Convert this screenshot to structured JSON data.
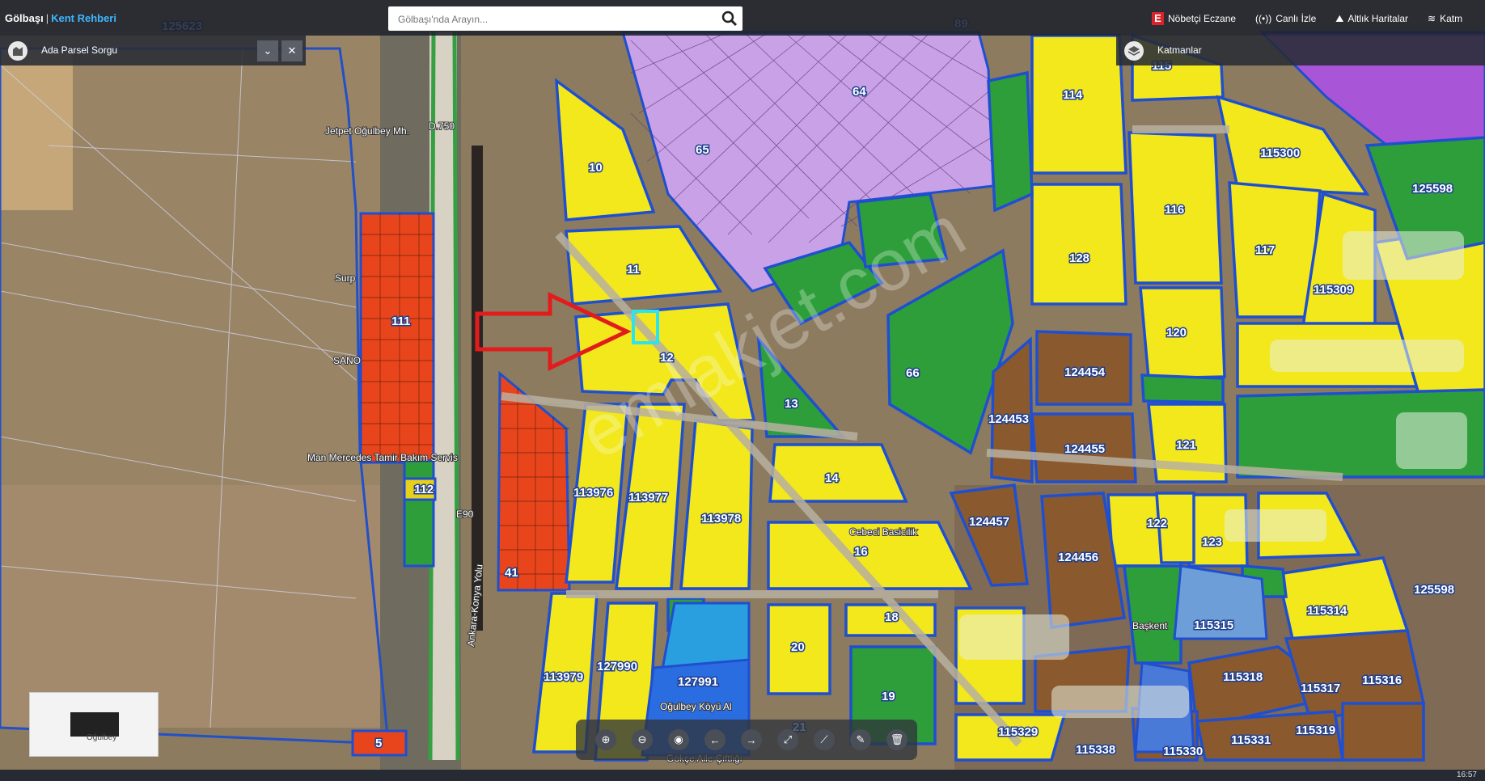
{
  "app": {
    "brand": "Gölbaşı",
    "brand_sub": "Kent Rehberi"
  },
  "search": {
    "placeholder": "Gölbaşı'nda Arayın..."
  },
  "top_links": [
    {
      "label": "Nöbetçi Eczane",
      "icon": "pharmacy-icon"
    },
    {
      "label": "Canlı İzle",
      "icon": "live-icon"
    },
    {
      "label": "Altlık Haritalar",
      "icon": "basemap-icon"
    },
    {
      "label": "Katm",
      "icon": "layers-icon"
    }
  ],
  "left_panel": {
    "title": "Ada Parsel Sorgu"
  },
  "right_panel": {
    "title": "Katmanlar"
  },
  "parcel_labels": [
    "125623",
    "89",
    "64",
    "65",
    "115",
    "114",
    "115300",
    "125598",
    "10",
    "11",
    "12",
    "116",
    "117",
    "128",
    "111",
    "66",
    "13",
    "120",
    "115309",
    "124454",
    "124453",
    "124455",
    "121",
    "14",
    "113976",
    "113977",
    "113978",
    "112",
    "124457",
    "122",
    "123",
    "16",
    "41",
    "124456",
    "125598",
    "115314",
    "115315",
    "18",
    "20",
    "113979",
    "127990",
    "127991",
    "115318",
    "115317",
    "115316",
    "19",
    "115329",
    "115319",
    "5",
    "115338",
    "115330",
    "115331",
    "21"
  ],
  "place_labels": [
    "Jetpet Oğulbey Mh.",
    "Surp",
    "SANO",
    "Man Mercedes Tamir Bakım Servis",
    "Ankara-Konya Yolu",
    "Oğulbey Köyü Al",
    "Gökçe Aile Çiftliği",
    "Cebeci Basicilik",
    "Başkent",
    "D.750",
    "E90"
  ],
  "toolbar": [
    {
      "name": "zoom-in-button",
      "icon": "zoom-in-icon",
      "glyph": "⊕"
    },
    {
      "name": "zoom-out-button",
      "icon": "zoom-out-icon",
      "glyph": "⊖"
    },
    {
      "name": "location-button",
      "icon": "location-icon",
      "glyph": "◉"
    },
    {
      "name": "back-button",
      "icon": "arrow-left-icon",
      "glyph": "←"
    },
    {
      "name": "forward-button",
      "icon": "arrow-right-icon",
      "glyph": "→"
    },
    {
      "name": "fullscreen-button",
      "icon": "fullscreen-icon",
      "glyph": "⤢"
    },
    {
      "name": "measure-button",
      "icon": "ruler-icon",
      "glyph": "⟋"
    },
    {
      "name": "draw-button",
      "icon": "edit-icon",
      "glyph": "✎"
    },
    {
      "name": "clear-button",
      "icon": "trash-icon",
      "glyph": "🗑"
    }
  ],
  "minimap": {
    "label": "Oğulbey"
  },
  "statusbar": {
    "time": "16:57"
  },
  "watermark": "emlakjet.com",
  "colors": {
    "residential": "#f2e81c",
    "green": "#2e9e3a",
    "commercial": "#e84c1e",
    "mixed": "#8a5a2e",
    "public": "#c9a1e6",
    "border": "#1f4fd1",
    "highlight": "#2ce4ef",
    "arrow": "#e21c1c"
  }
}
